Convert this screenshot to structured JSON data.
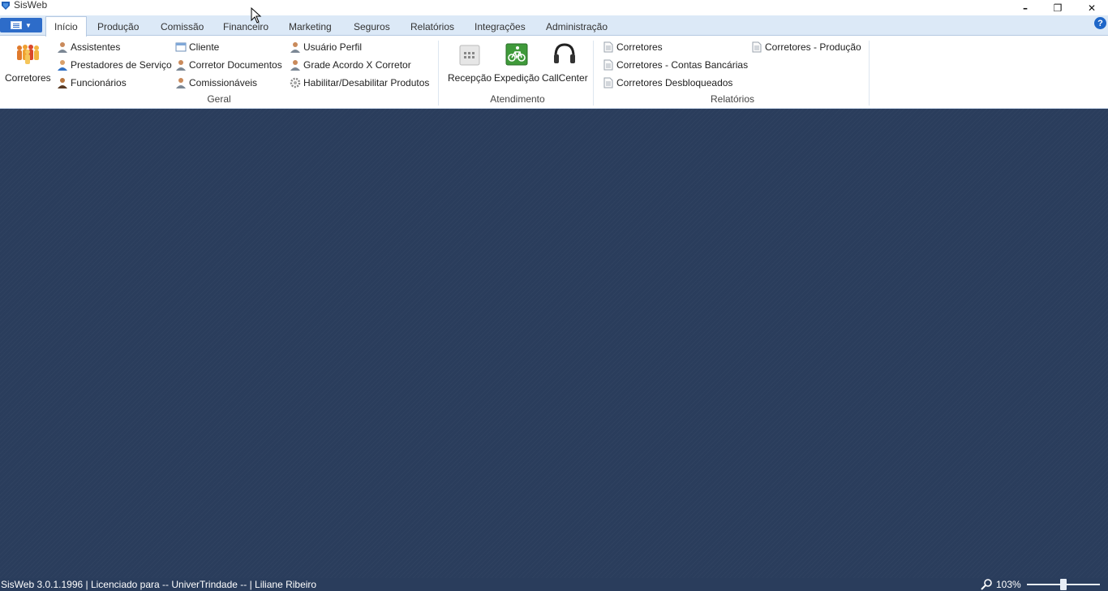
{
  "window": {
    "title": "SisWeb",
    "minimize_glyph": "–",
    "restore_glyph": "❐",
    "close_glyph": "✕"
  },
  "tabs": [
    {
      "label": "Início",
      "active": true
    },
    {
      "label": "Produção"
    },
    {
      "label": "Comissão"
    },
    {
      "label": "Financeiro"
    },
    {
      "label": "Marketing"
    },
    {
      "label": "Seguros"
    },
    {
      "label": "Relatórios"
    },
    {
      "label": "Integrações"
    },
    {
      "label": "Administração"
    }
  ],
  "help_glyph": "?",
  "ribbon": {
    "geral": {
      "label": "Geral",
      "big_button": {
        "label": "Corretores",
        "icon": "people-group-icon"
      },
      "items": [
        {
          "label": "Assistentes",
          "icon": "person-icon"
        },
        {
          "label": "Prestadores de Serviço",
          "icon": "person-blue-icon"
        },
        {
          "label": "Funcionários",
          "icon": "person-dark-icon"
        },
        {
          "label": "Cliente",
          "icon": "window-icon"
        },
        {
          "label": "Corretor Documentos",
          "icon": "person-icon"
        },
        {
          "label": "Comissionáveis",
          "icon": "person-icon"
        },
        {
          "label": "Usuário Perfil",
          "icon": "person-icon"
        },
        {
          "label": "Grade Acordo X Corretor",
          "icon": "person-icon"
        },
        {
          "label": "Habilitar/Desabilitar Produtos",
          "icon": "gear-icon"
        }
      ]
    },
    "atendimento": {
      "label": "Atendimento",
      "buttons": [
        {
          "label": "Recepção",
          "icon": "building-icon"
        },
        {
          "label": "Expedição",
          "icon": "bicycle-icon"
        },
        {
          "label": "CallCenter",
          "icon": "headset-icon"
        }
      ]
    },
    "relatorios": {
      "label": "Relatórios",
      "items": [
        {
          "label": "Corretores",
          "icon": "document-icon"
        },
        {
          "label": "Corretores - Contas Bancárias",
          "icon": "document-icon"
        },
        {
          "label": "Corretores Desbloqueados",
          "icon": "document-icon"
        },
        {
          "label": "Corretores - Produção",
          "icon": "document-icon"
        }
      ]
    }
  },
  "statusbar": {
    "text": "SisWeb 3.0.1.1996 | Licenciado para -- UniverTrindade -- | Liliane Ribeiro",
    "zoom": "103%",
    "zoom_level": 0.5
  },
  "colors": {
    "workspace": "#2a3d5c",
    "tabstrip": "#dce9f7",
    "accent": "#2d6cc9"
  }
}
